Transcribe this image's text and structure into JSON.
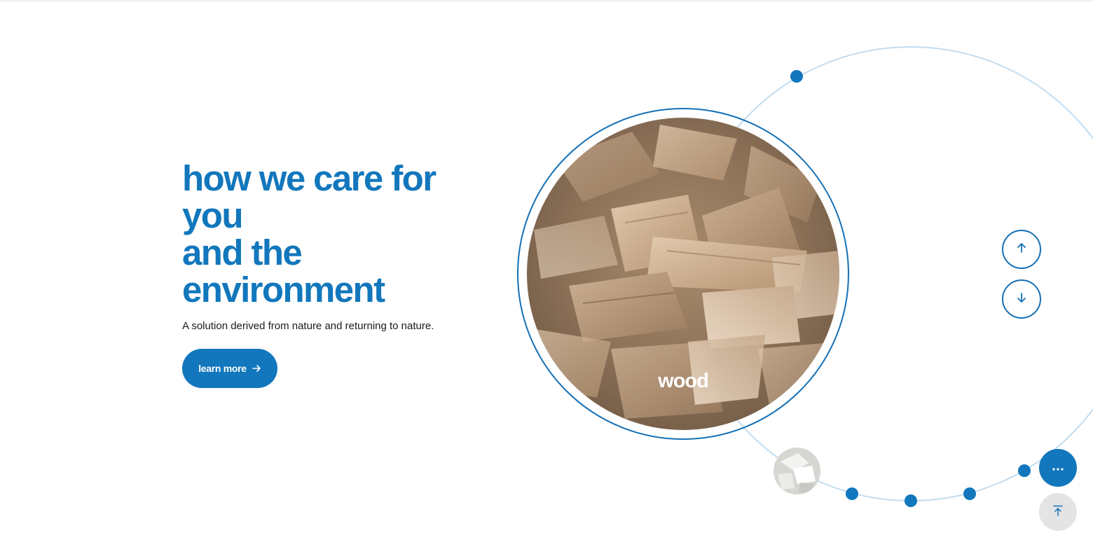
{
  "hero": {
    "title_line1": "how we care for",
    "title_line2": "you",
    "title_line3": "and the",
    "title_line4": "environment",
    "subtitle": "A solution derived from nature and returning to nature.",
    "cta_label": "learn more"
  },
  "carousel": {
    "active_label": "wood",
    "active_image": "wood-chips-photo",
    "next_image": "white-flakes-photo",
    "item_count": 6
  },
  "controls": {
    "up_icon": "arrow-up-icon",
    "down_icon": "arrow-down-icon",
    "more_icon": "ellipsis-icon",
    "top_icon": "scroll-to-top-icon"
  },
  "colors": {
    "accent": "#1277bc",
    "orbit_line": "#c2dcef",
    "text": "#1a1a1a",
    "muted_button": "#e4e4e4"
  }
}
